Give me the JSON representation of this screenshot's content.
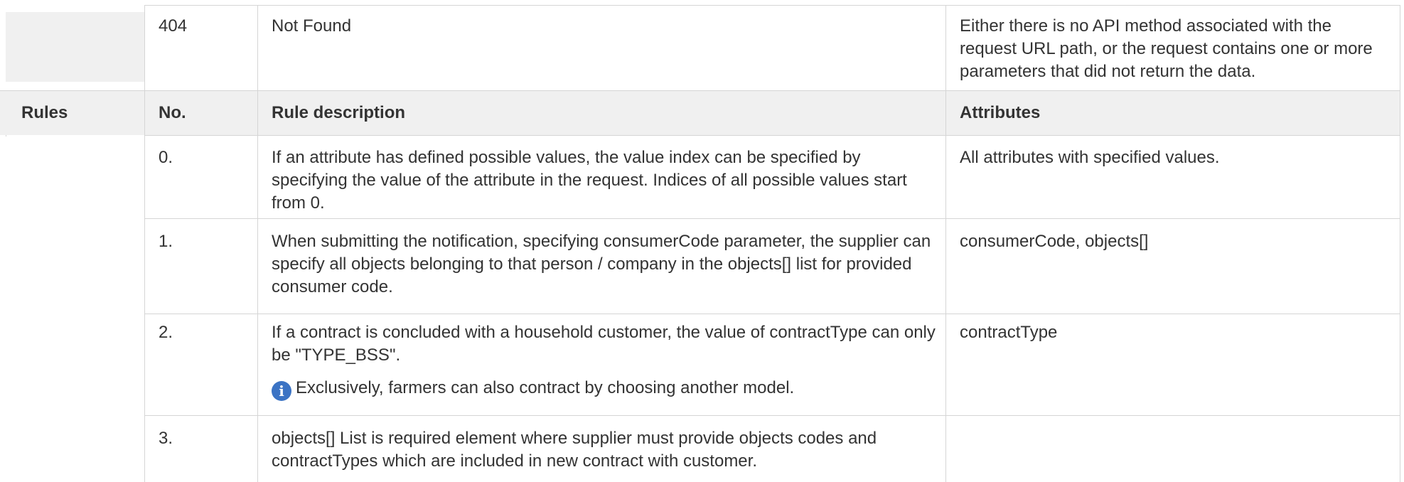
{
  "status_row": {
    "code": "404",
    "message": "Not Found",
    "description": "Either there is no API method associated with the request URL path, or the request contains one or more parameters that did not return the data."
  },
  "rules": {
    "section_label": "Rules",
    "header": {
      "no": "No.",
      "description": "Rule description",
      "attributes": "Attributes"
    },
    "rows": [
      {
        "no": "0.",
        "description": "If an attribute has defined possible values, the value index can be specified by specifying the value of the attribute in the request. Indices of all possible values start from 0.",
        "attributes": "All attributes with specified values."
      },
      {
        "no": "1.",
        "description": "When submitting the notification, specifying consumerCode parameter, the supplier can specify all objects belonging to that person / company in the objects[] list for provided consumer code.",
        "attributes": "consumerCode, objects[]"
      },
      {
        "no": "2.",
        "description": "If a contract is concluded with a household customer, the value of contractType can only be \"TYPE_BSS\".",
        "note": "Exclusively, farmers can also contract by choosing another model.",
        "note_icon": "info-icon",
        "attributes": "contractType"
      },
      {
        "no": "3.",
        "description": "objects[] List is required element where supplier must provide objects codes and contractTypes which are included in new contract with customer.",
        "attributes": ""
      }
    ]
  },
  "colors": {
    "header_bg": "#f0f0f0",
    "border": "#d5d5d5",
    "text": "#333333",
    "info_icon": "#3b73c4"
  }
}
